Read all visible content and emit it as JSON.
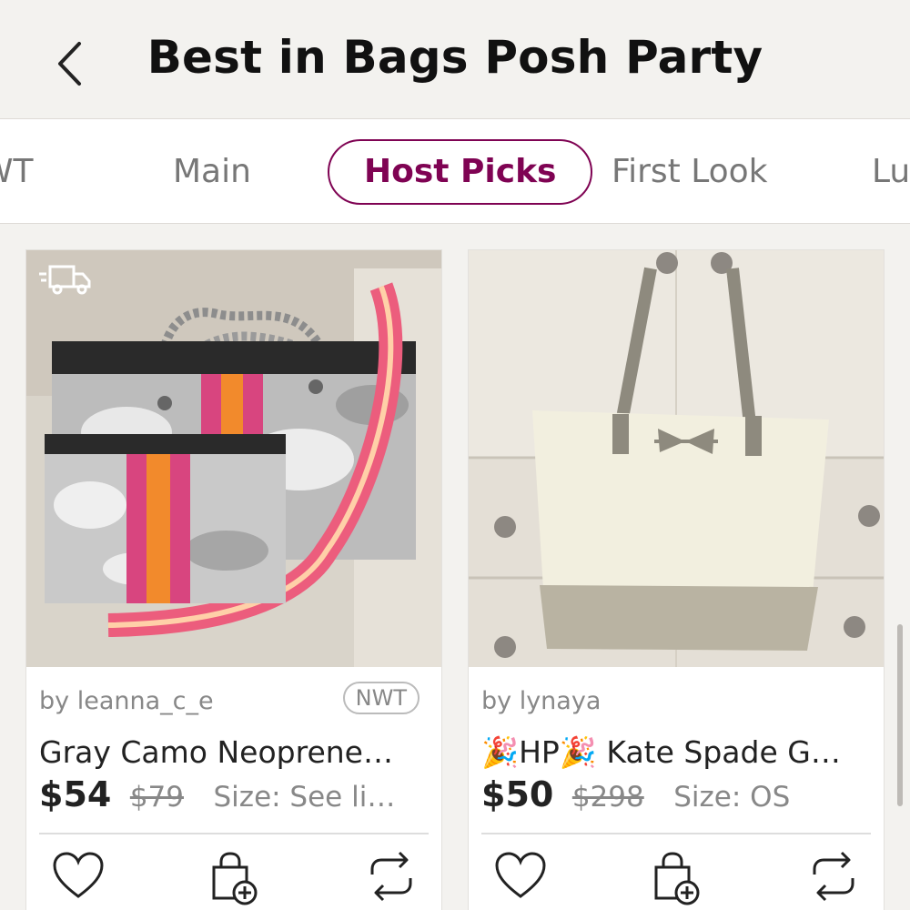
{
  "header": {
    "title": "Best in Bags Posh Party",
    "back_icon": "chevron-left-icon"
  },
  "tabs": {
    "items": [
      {
        "label": "NWT"
      },
      {
        "label": "Main"
      },
      {
        "label": "Host Picks",
        "active": true
      },
      {
        "label": "First Look"
      },
      {
        "label": "Luxury"
      }
    ]
  },
  "colors": {
    "accent": "#7f0353",
    "muted": "#888888",
    "background": "#f3f2ef"
  },
  "listings": [
    {
      "seller": "by leanna_c_e",
      "badge": "NWT",
      "title": "Gray Camo Neoprene…",
      "price": "$54",
      "original_price": "$79",
      "size": "Size: See li…",
      "ship_icon": "truck-icon",
      "icons": [
        "heart-icon",
        "bag-add-icon",
        "share-icon"
      ]
    },
    {
      "seller": "by lynaya",
      "title": "🎉HP🎉 Kate Spade G…",
      "price": "$50",
      "original_price": "$298",
      "size": "Size: OS",
      "icons": [
        "heart-icon",
        "bag-add-icon",
        "share-icon"
      ]
    }
  ]
}
